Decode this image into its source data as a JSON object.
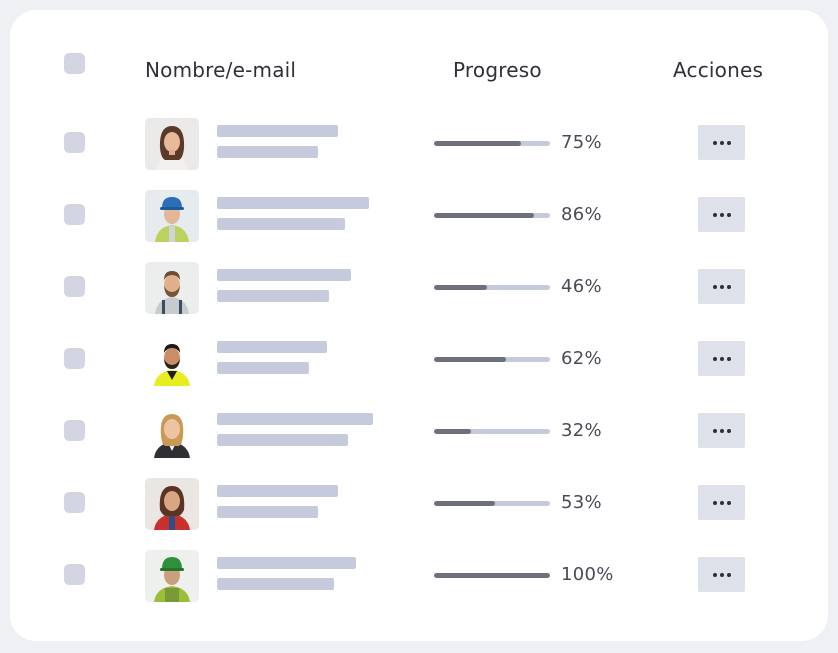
{
  "table": {
    "columns": {
      "name_email": "Nombre/e-mail",
      "progress": "Progreso",
      "actions": "Acciones"
    },
    "rows": [
      {
        "progress_percent": 75,
        "progress_label": "75%",
        "actions_label": "•••",
        "avatar_icon": "avatar-woman-brown-hair-icon"
      },
      {
        "progress_percent": 86,
        "progress_label": "86%",
        "actions_label": "•••",
        "avatar_icon": "avatar-worker-blue-helmet-icon"
      },
      {
        "progress_percent": 46,
        "progress_label": "46%",
        "actions_label": "•••",
        "avatar_icon": "avatar-bearded-man-icon"
      },
      {
        "progress_percent": 62,
        "progress_label": "62%",
        "actions_label": "•••",
        "avatar_icon": "avatar-man-hivis-vest-icon"
      },
      {
        "progress_percent": 32,
        "progress_label": "32%",
        "actions_label": "•••",
        "avatar_icon": "avatar-blonde-woman-icon"
      },
      {
        "progress_percent": 53,
        "progress_label": "53%",
        "actions_label": "•••",
        "avatar_icon": "avatar-woman-red-shirt-icon"
      },
      {
        "progress_percent": 100,
        "progress_label": "100%",
        "actions_label": "•••",
        "avatar_icon": "avatar-worker-green-helmet-icon"
      }
    ]
  },
  "colors": {
    "background": "#eef0f4",
    "card": "#ffffff",
    "placeholder_bar": "#c6cadd",
    "progress_fill": "#6e717b",
    "checkbox": "#d3d6e2",
    "action_button": "#dfe1ea"
  }
}
